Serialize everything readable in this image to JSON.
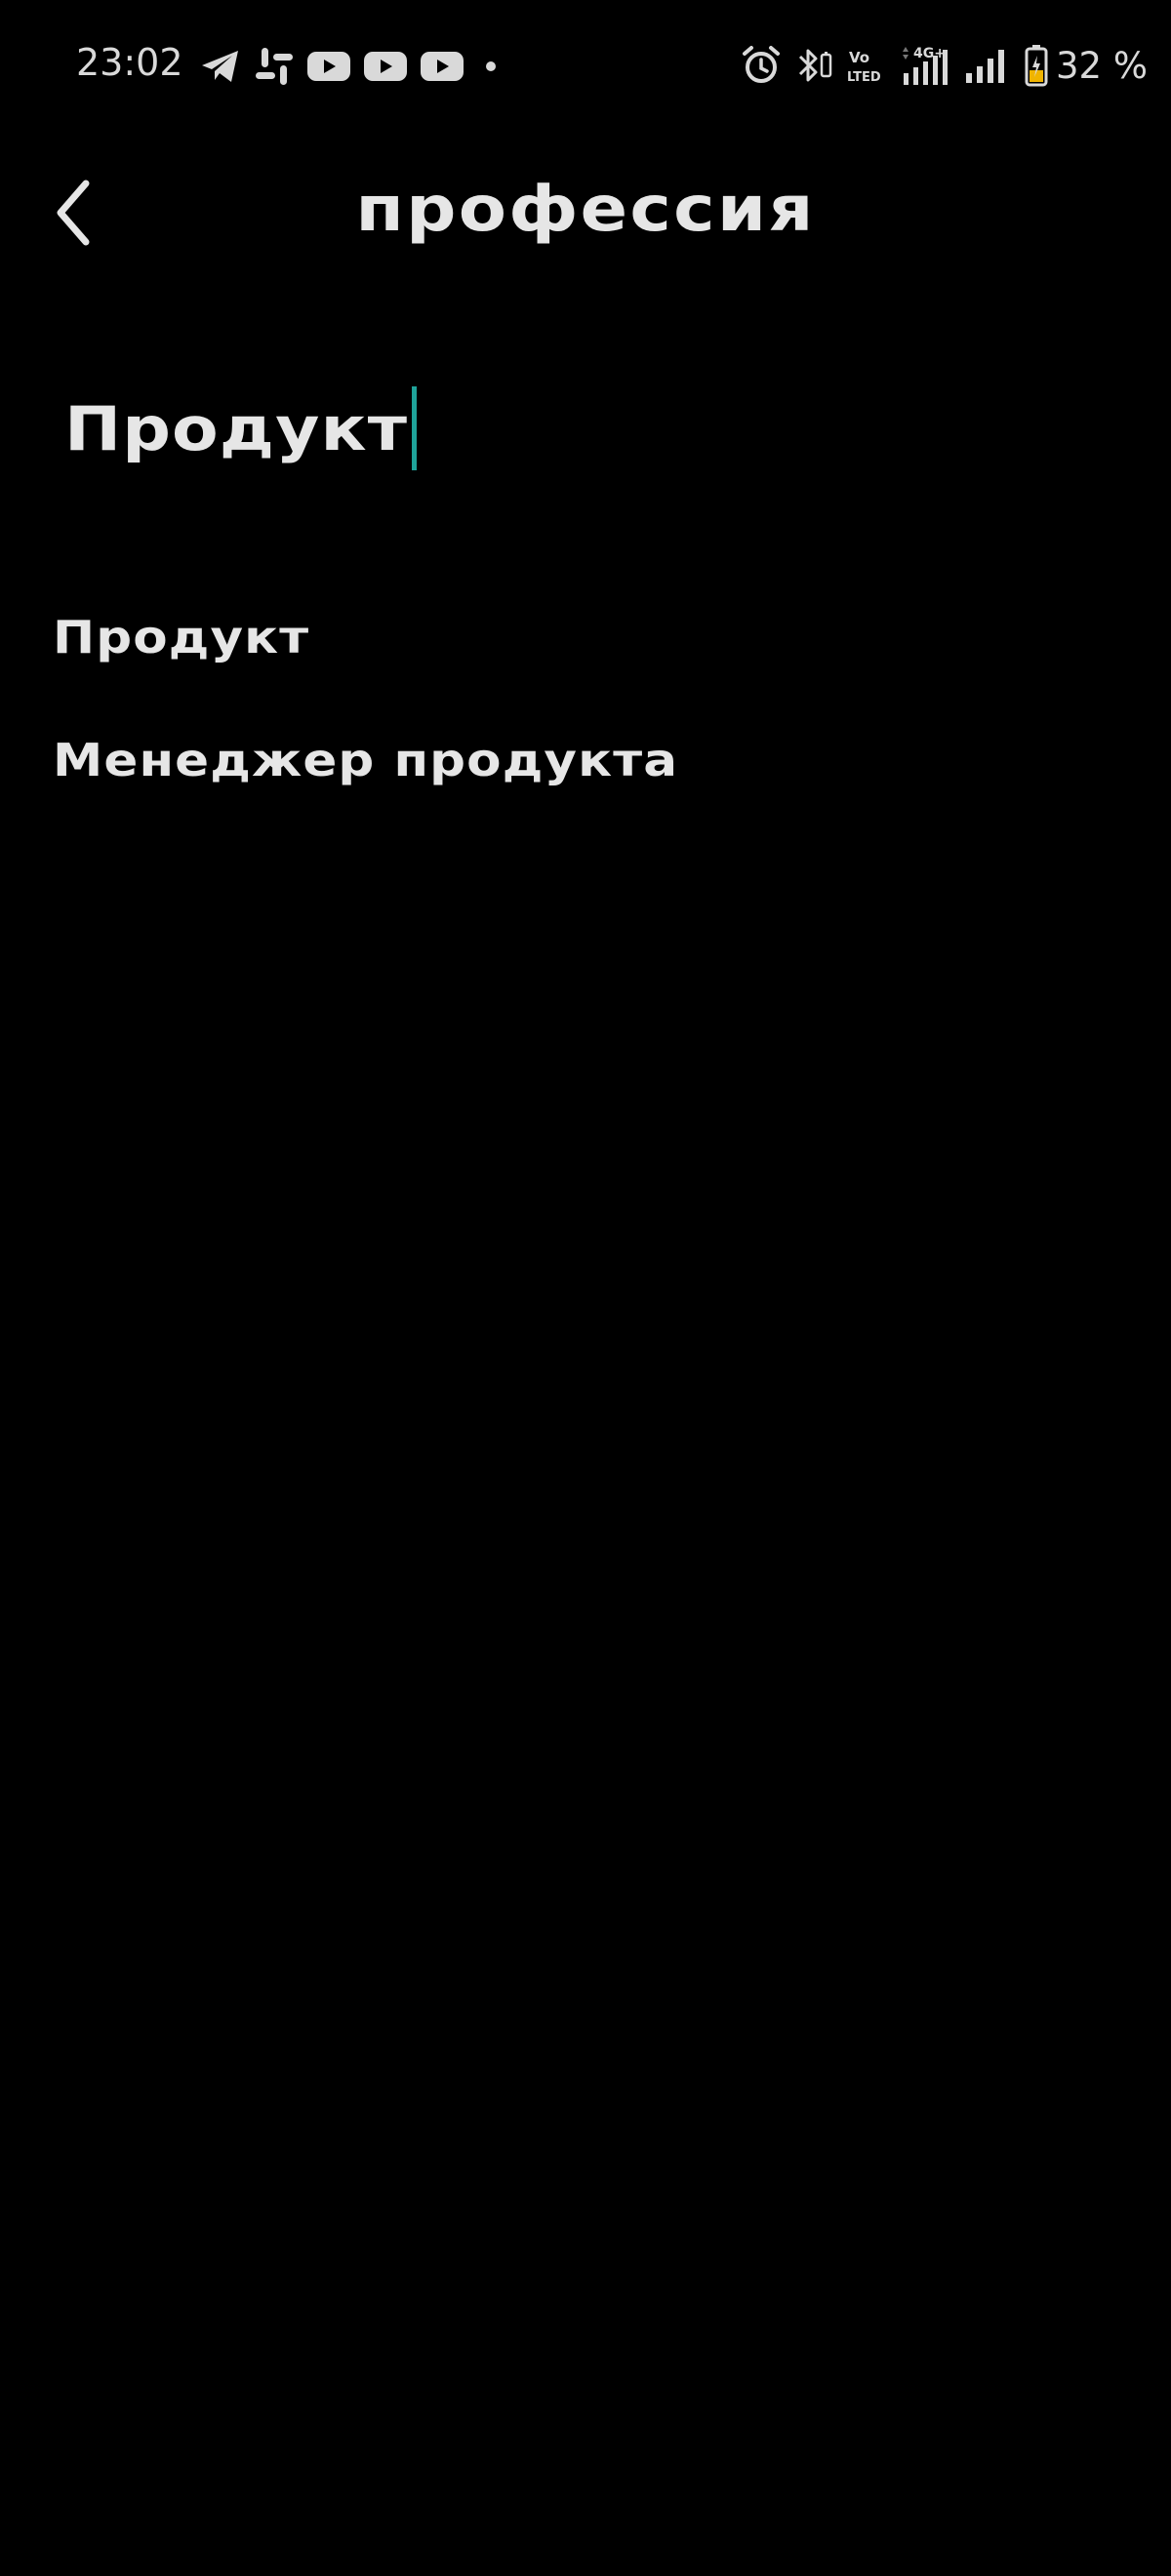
{
  "status_bar": {
    "time": "23:02",
    "battery_percent": "32 %",
    "left_icons": [
      "telegram-icon",
      "slack-icon",
      "youtube-icon",
      "youtube-icon",
      "youtube-icon",
      "dot-icon"
    ],
    "right_icons": [
      "alarm-icon",
      "bluetooth-icon",
      "volte-icon",
      "signal-4g-icon",
      "signal-icon",
      "battery-charging-icon"
    ]
  },
  "header": {
    "title": "профессия",
    "back_icon": "chevron-left-icon"
  },
  "search": {
    "value": "Продукт",
    "caret_color": "#1fa39a"
  },
  "suggestions": [
    {
      "label": "Продукт"
    },
    {
      "label": "Менеджер продукта"
    }
  ],
  "colors": {
    "background": "#000000",
    "text": "#e6e6e6",
    "accent": "#1fa39a",
    "battery_fill": "#f0b400"
  }
}
